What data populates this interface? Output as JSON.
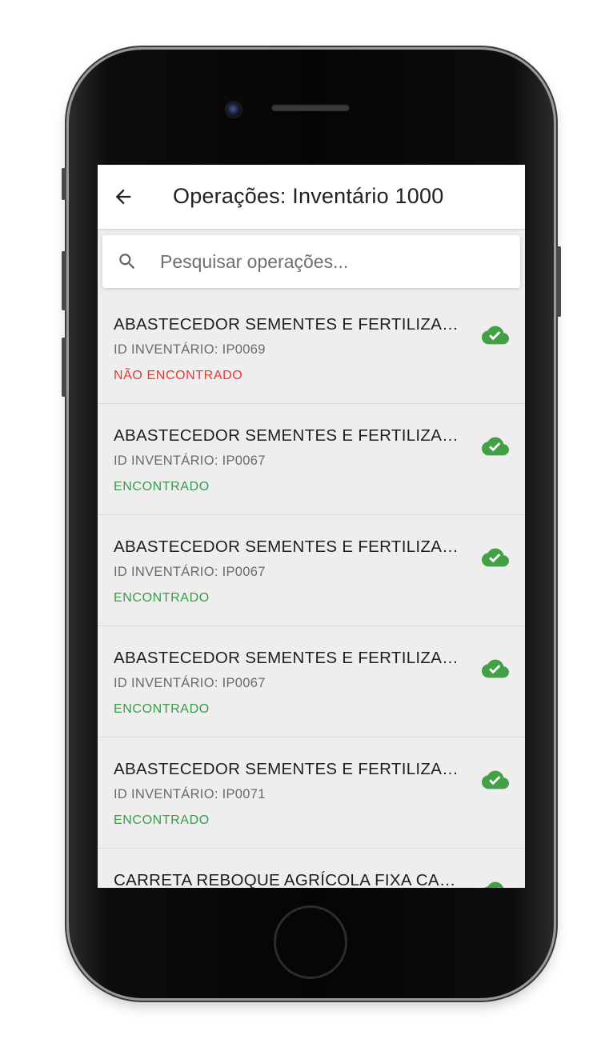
{
  "appbar": {
    "title": "Operações: Inventário 1000"
  },
  "search": {
    "placeholder": "Pesquisar operações..."
  },
  "colors": {
    "found": "#3a9a48",
    "not_found": "#e53935",
    "synced_icon": "#43a047"
  },
  "icons": {
    "back": "arrow-back-icon",
    "search": "search-icon",
    "synced": "cloud-done-icon"
  },
  "items": [
    {
      "title": "ABASTECEDOR SEMENTES E FERTILIZANTES...",
      "id_line": "ID INVENTÁRIO: IP0069",
      "status": "NÃO ENCONTRADO",
      "status_type": "not_found"
    },
    {
      "title": "ABASTECEDOR SEMENTES E FERTILIZANTES...",
      "id_line": "ID INVENTÁRIO: IP0067",
      "status": "ENCONTRADO",
      "status_type": "found"
    },
    {
      "title": "ABASTECEDOR SEMENTES E FERTILIZANTES...",
      "id_line": "ID INVENTÁRIO: IP0067",
      "status": "ENCONTRADO",
      "status_type": "found"
    },
    {
      "title": "ABASTECEDOR SEMENTES E FERTILIZANTES...",
      "id_line": "ID INVENTÁRIO: IP0067",
      "status": "ENCONTRADO",
      "status_type": "found"
    },
    {
      "title": "ABASTECEDOR SEMENTES E FERTILIZANTES...",
      "id_line": "ID INVENTÁRIO: IP0071",
      "status": "ENCONTRADO",
      "status_type": "found"
    },
    {
      "title": "CARRETA REBOQUE AGRÍCOLA FIXA CARGA S...",
      "id_line": "",
      "status": "",
      "status_type": "found"
    }
  ]
}
